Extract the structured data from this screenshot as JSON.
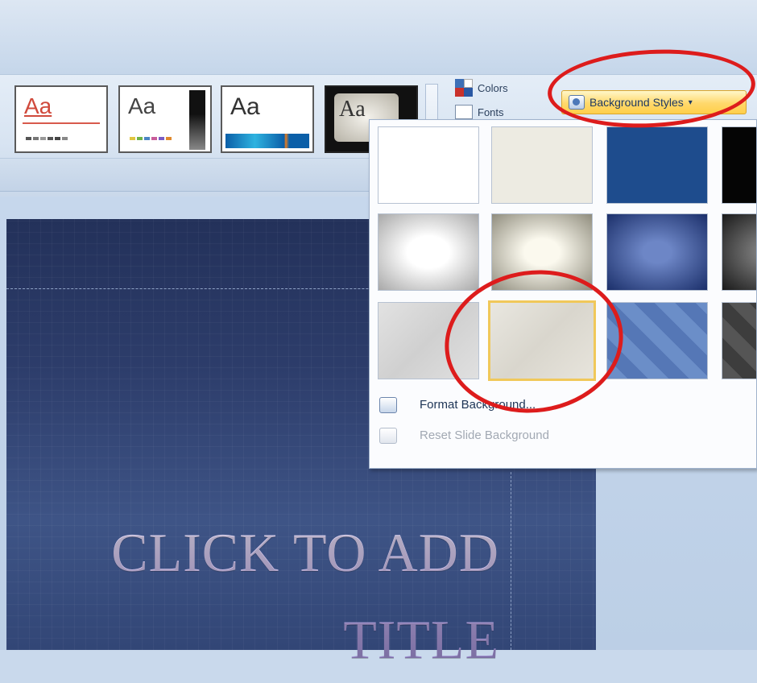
{
  "ribbon": {
    "themes_gallery": [
      {
        "sample": "Aa"
      },
      {
        "sample": "Aa"
      },
      {
        "sample": "Aa"
      },
      {
        "sample": "Aa"
      }
    ],
    "colors_label": "Colors",
    "fonts_label": "Fonts",
    "background_styles_label": "Background Styles",
    "background_styles_arrow": "▾"
  },
  "dropdown": {
    "swatch_grid": [
      [
        "White",
        "Cream",
        "Dark Blue",
        "Black"
      ],
      [
        "White Radial Gradient",
        "Cream Radial Gradient",
        "Blue Radial Gradient",
        "Gray Radial Gradient"
      ],
      [
        "Light Gray Texture",
        "Light Texture",
        "Blue Diamond",
        "Gray Diamond"
      ]
    ],
    "selected_swatch": "Light Texture",
    "menu": {
      "format_background": "Format Background...",
      "reset_slide_background": "Reset Slide Background"
    }
  },
  "slide": {
    "title_line1": "CLICK TO ADD",
    "title_line2": "TITLE"
  },
  "colors": {
    "highlight": "#dd1c1c",
    "selection": "#f0c85a",
    "button_hover": "#ffd86b"
  }
}
